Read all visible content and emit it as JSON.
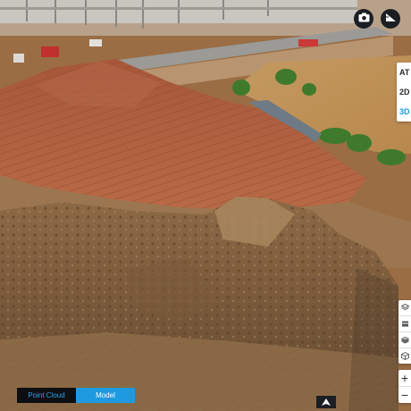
{
  "view_tabs": [
    {
      "label": "AT",
      "active": false
    },
    {
      "label": "2D",
      "active": false
    },
    {
      "label": "3D",
      "active": true
    }
  ],
  "mode_switch": {
    "point_cloud": "Point Cloud",
    "model": "Model",
    "selected": "Model"
  },
  "zoom": {
    "in": "+",
    "out": "−"
  },
  "icons": {
    "top_left": "camera-icon",
    "top_right": "measure-icon",
    "tools": [
      "layers-icon",
      "cube-solid-icon",
      "cube-outline-icon"
    ],
    "bottom": "compass-icon"
  },
  "colors": {
    "accent": "#1e9be0",
    "dark": "#0d0f12"
  }
}
